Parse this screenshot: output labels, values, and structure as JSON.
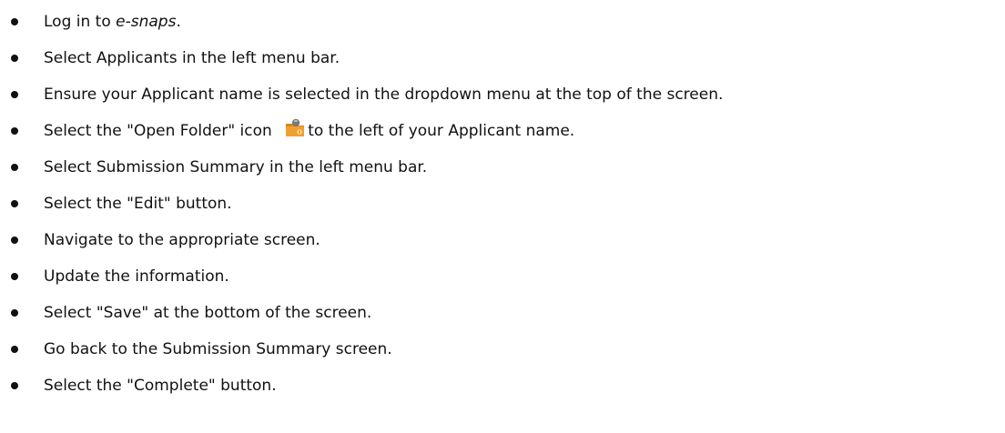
{
  "steps": [
    {
      "before": "Log in to ",
      "emph": "e-snaps",
      "after": "."
    },
    {
      "text": "Select Applicants in the left menu bar."
    },
    {
      "text": "Ensure your Applicant name is selected in the dropdown menu at the top of the screen."
    },
    {
      "before": "Select the \"Open Folder\" icon ",
      "icon": "open-folder-icon",
      "after": "to the left of your Applicant name."
    },
    {
      "text": "Select Submission Summary in the left menu bar."
    },
    {
      "text": "Select the \"Edit\" button."
    },
    {
      "text": "Navigate to the appropriate screen."
    },
    {
      "text": "Update the information."
    },
    {
      "text": "Select \"Save\" at the bottom of the screen."
    },
    {
      "text": "Go back to the Submission Summary screen."
    },
    {
      "text": "Select the \"Complete\" button."
    }
  ],
  "colors": {
    "text": "#111111",
    "folder": "#f0a030",
    "folder_tab": "#d8871a",
    "badge": "#7a7a7a"
  }
}
